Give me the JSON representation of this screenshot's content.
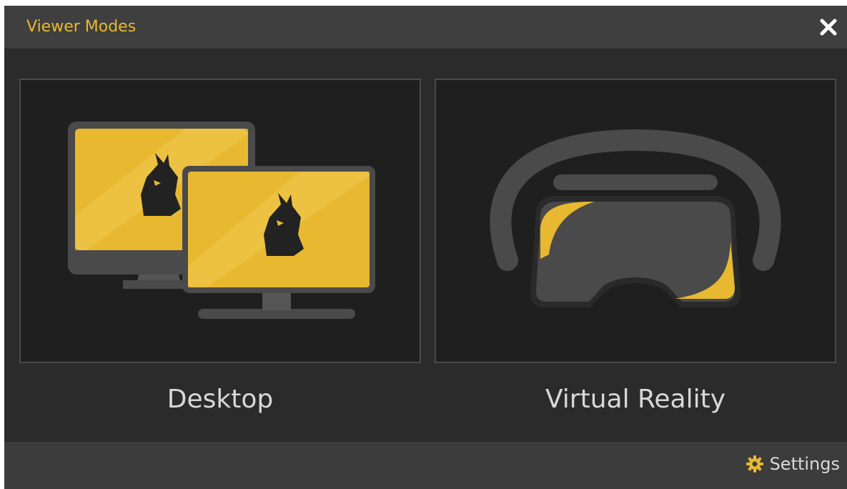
{
  "window": {
    "title": "Viewer Modes",
    "close_icon": "close-icon"
  },
  "modes": [
    {
      "label": "Desktop",
      "icon": "dual-monitor-icon"
    },
    {
      "label": "Virtual Reality",
      "icon": "vr-headset-icon"
    }
  ],
  "footer": {
    "settings_label": "Settings",
    "settings_icon": "gear-icon"
  },
  "colors": {
    "accent": "#e8b830",
    "panel_bg": "#2b2b2b",
    "card_bg": "#1f1f1f",
    "titlebar_bg": "#3f3f3f",
    "icon_gray": "#4a4a4a"
  }
}
